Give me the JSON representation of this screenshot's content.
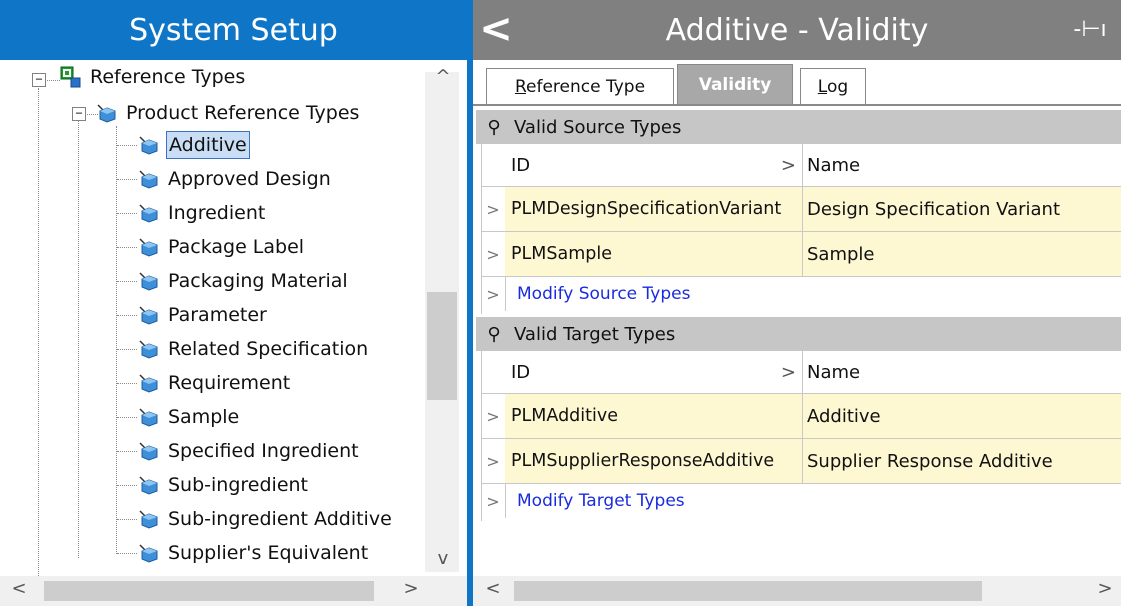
{
  "left_panel": {
    "title": "System Setup",
    "tree": {
      "root_label": "Reference Types",
      "group_label": "Product Reference Types",
      "items": [
        {
          "label": "Additive",
          "selected": true
        },
        {
          "label": "Approved Design"
        },
        {
          "label": "Ingredient"
        },
        {
          "label": "Package Label"
        },
        {
          "label": "Packaging Material"
        },
        {
          "label": "Parameter"
        },
        {
          "label": "Related Specification"
        },
        {
          "label": "Requirement"
        },
        {
          "label": "Sample"
        },
        {
          "label": "Specified Ingredient"
        },
        {
          "label": "Sub-ingredient"
        },
        {
          "label": "Sub-ingredient Additive"
        },
        {
          "label": "Supplier's Equivalent"
        }
      ]
    }
  },
  "right_panel": {
    "title": "Additive - Validity",
    "tabs": [
      {
        "label": "Reference Type",
        "mnemonic": "R",
        "rest": "eference Type"
      },
      {
        "label": "Validity",
        "active": true
      },
      {
        "label": "Log",
        "mnemonic": "L",
        "rest": "og"
      }
    ],
    "source_section": {
      "title": "Valid Source Types",
      "columns": [
        "ID",
        "Name"
      ],
      "rows": [
        {
          "id": "PLMDesignSpecificationVariant",
          "name": "Design Specification Variant"
        },
        {
          "id": "PLMSample",
          "name": "Sample"
        }
      ],
      "action_link": "Modify Source Types"
    },
    "target_section": {
      "title": "Valid Target Types",
      "columns": [
        "ID",
        "Name"
      ],
      "rows": [
        {
          "id": "PLMAdditive",
          "name": "Additive"
        },
        {
          "id": "PLMSupplierResponseAdditive",
          "name": "Supplier Response Additive"
        }
      ],
      "action_link": "Modify Target Types"
    }
  },
  "colors": {
    "left_header": "#0f76c7",
    "right_header": "#808080",
    "section_header": "#c6c6c6",
    "data_cell": "#fdf7d2",
    "link": "#1a2bdc",
    "selection": "#c9def4"
  },
  "icons": {
    "back": "chevron-left-icon",
    "pin": "pin-icon",
    "tree_item": "cube-icon",
    "root": "reference-types-icon",
    "section": "pin-icon"
  }
}
